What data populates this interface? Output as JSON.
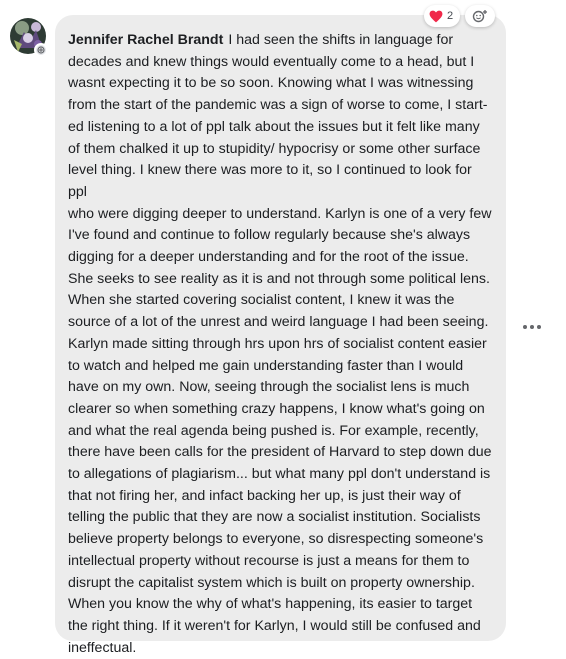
{
  "comment": {
    "author": "Jennifer Rachel Brandt",
    "lines": [
      "I had seen the shifts in language for",
      "decades and knew things would eventually come to a head, but I",
      "wasnt expecting it to be so soon. Knowing what I was witnessing",
      "from the start of the pandemic was a sign of worse to come, I start-",
      "ed listening to a lot of ppl talk about the issues but it felt like many",
      "of them chalked it up to stupidity/ hypocrisy or some other surface",
      "level thing. I knew there was more to it, so I continued to look for ppl",
      "who were digging deeper to understand. Karlyn is one of a very few",
      "I've found and continue to follow regularly because she's always",
      "digging for a deeper understanding and for the root of the issue.",
      "She seeks to see reality as it is and not through some political lens.",
      "When she started covering socialist content, I knew it was the",
      "source of a lot of the unrest and weird language I had been seeing.",
      "Karlyn made sitting through hrs upon hrs of socialist content easier",
      "to watch and helped me gain understanding faster than I would",
      "have on my own. Now, seeing through the socialist lens is much",
      "clearer so when something crazy happens, I know what's going on",
      "and what the real agenda being pushed is. For example, recently,",
      "there have been calls for the president of Harvard to step down due",
      "to allegations of plagiarism... but what many ppl don't understand is",
      "that not firing her, and infact backing her up, is just their way of",
      "telling the public that they are now a socialist institution. Socialists",
      "believe property belongs to everyone, so disrespecting someone's",
      "intellectual property without recourse is just a means for them to",
      "disrupt the capitalist system which is built on property ownership.",
      "When you know the why of what's happening, its easier to target",
      "the right thing. If it weren't for Karlyn, I would still be confused and",
      "ineffectual."
    ]
  },
  "reactions": {
    "icon": "heart-icon",
    "count": "2",
    "add_icon": "add-reaction-icon",
    "heart_color": "#f0284a"
  },
  "menu_icon": "more-options-icon",
  "colors": {
    "bubble": "#ececec",
    "text": "#1c1e21"
  }
}
